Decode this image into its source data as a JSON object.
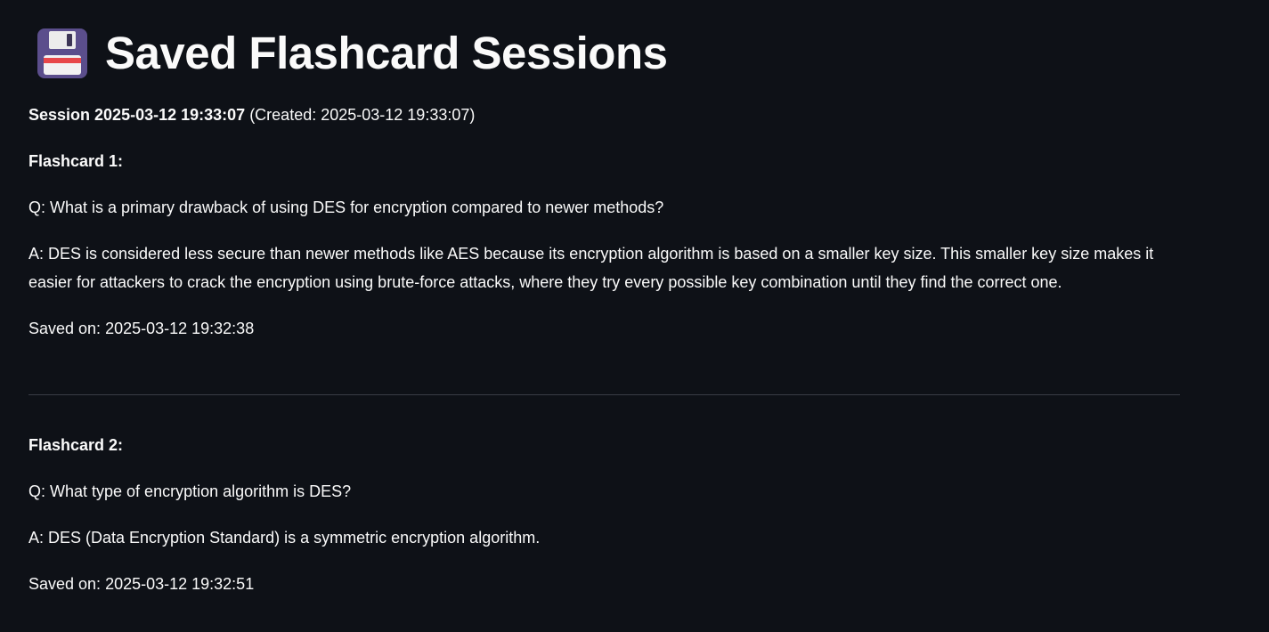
{
  "page": {
    "title": "Saved Flashcard Sessions",
    "title_icon": "floppy-disk-icon"
  },
  "session": {
    "name": "Session 2025-03-12 19:33:07",
    "created": "(Created: 2025-03-12 19:33:07)"
  },
  "flashcards": [
    {
      "label": "Flashcard 1:",
      "question": "Q: What is a primary drawback of using DES for encryption compared to newer methods?",
      "answer": "A: DES is considered less secure than newer methods like AES because its encryption algorithm is based on a smaller key size. This smaller key size makes it easier for attackers to crack the encryption using brute-force attacks, where they try every possible key combination until they find the correct one.",
      "saved": "Saved on: 2025-03-12 19:32:38"
    },
    {
      "label": "Flashcard 2:",
      "question": "Q: What type of encryption algorithm is DES?",
      "answer": "A: DES (Data Encryption Standard) is a symmetric encryption algorithm.",
      "saved": "Saved on: 2025-03-12 19:32:51"
    }
  ],
  "colors": {
    "background": "#0e1117",
    "text": "#fafafa",
    "divider": "#3a3d45"
  }
}
